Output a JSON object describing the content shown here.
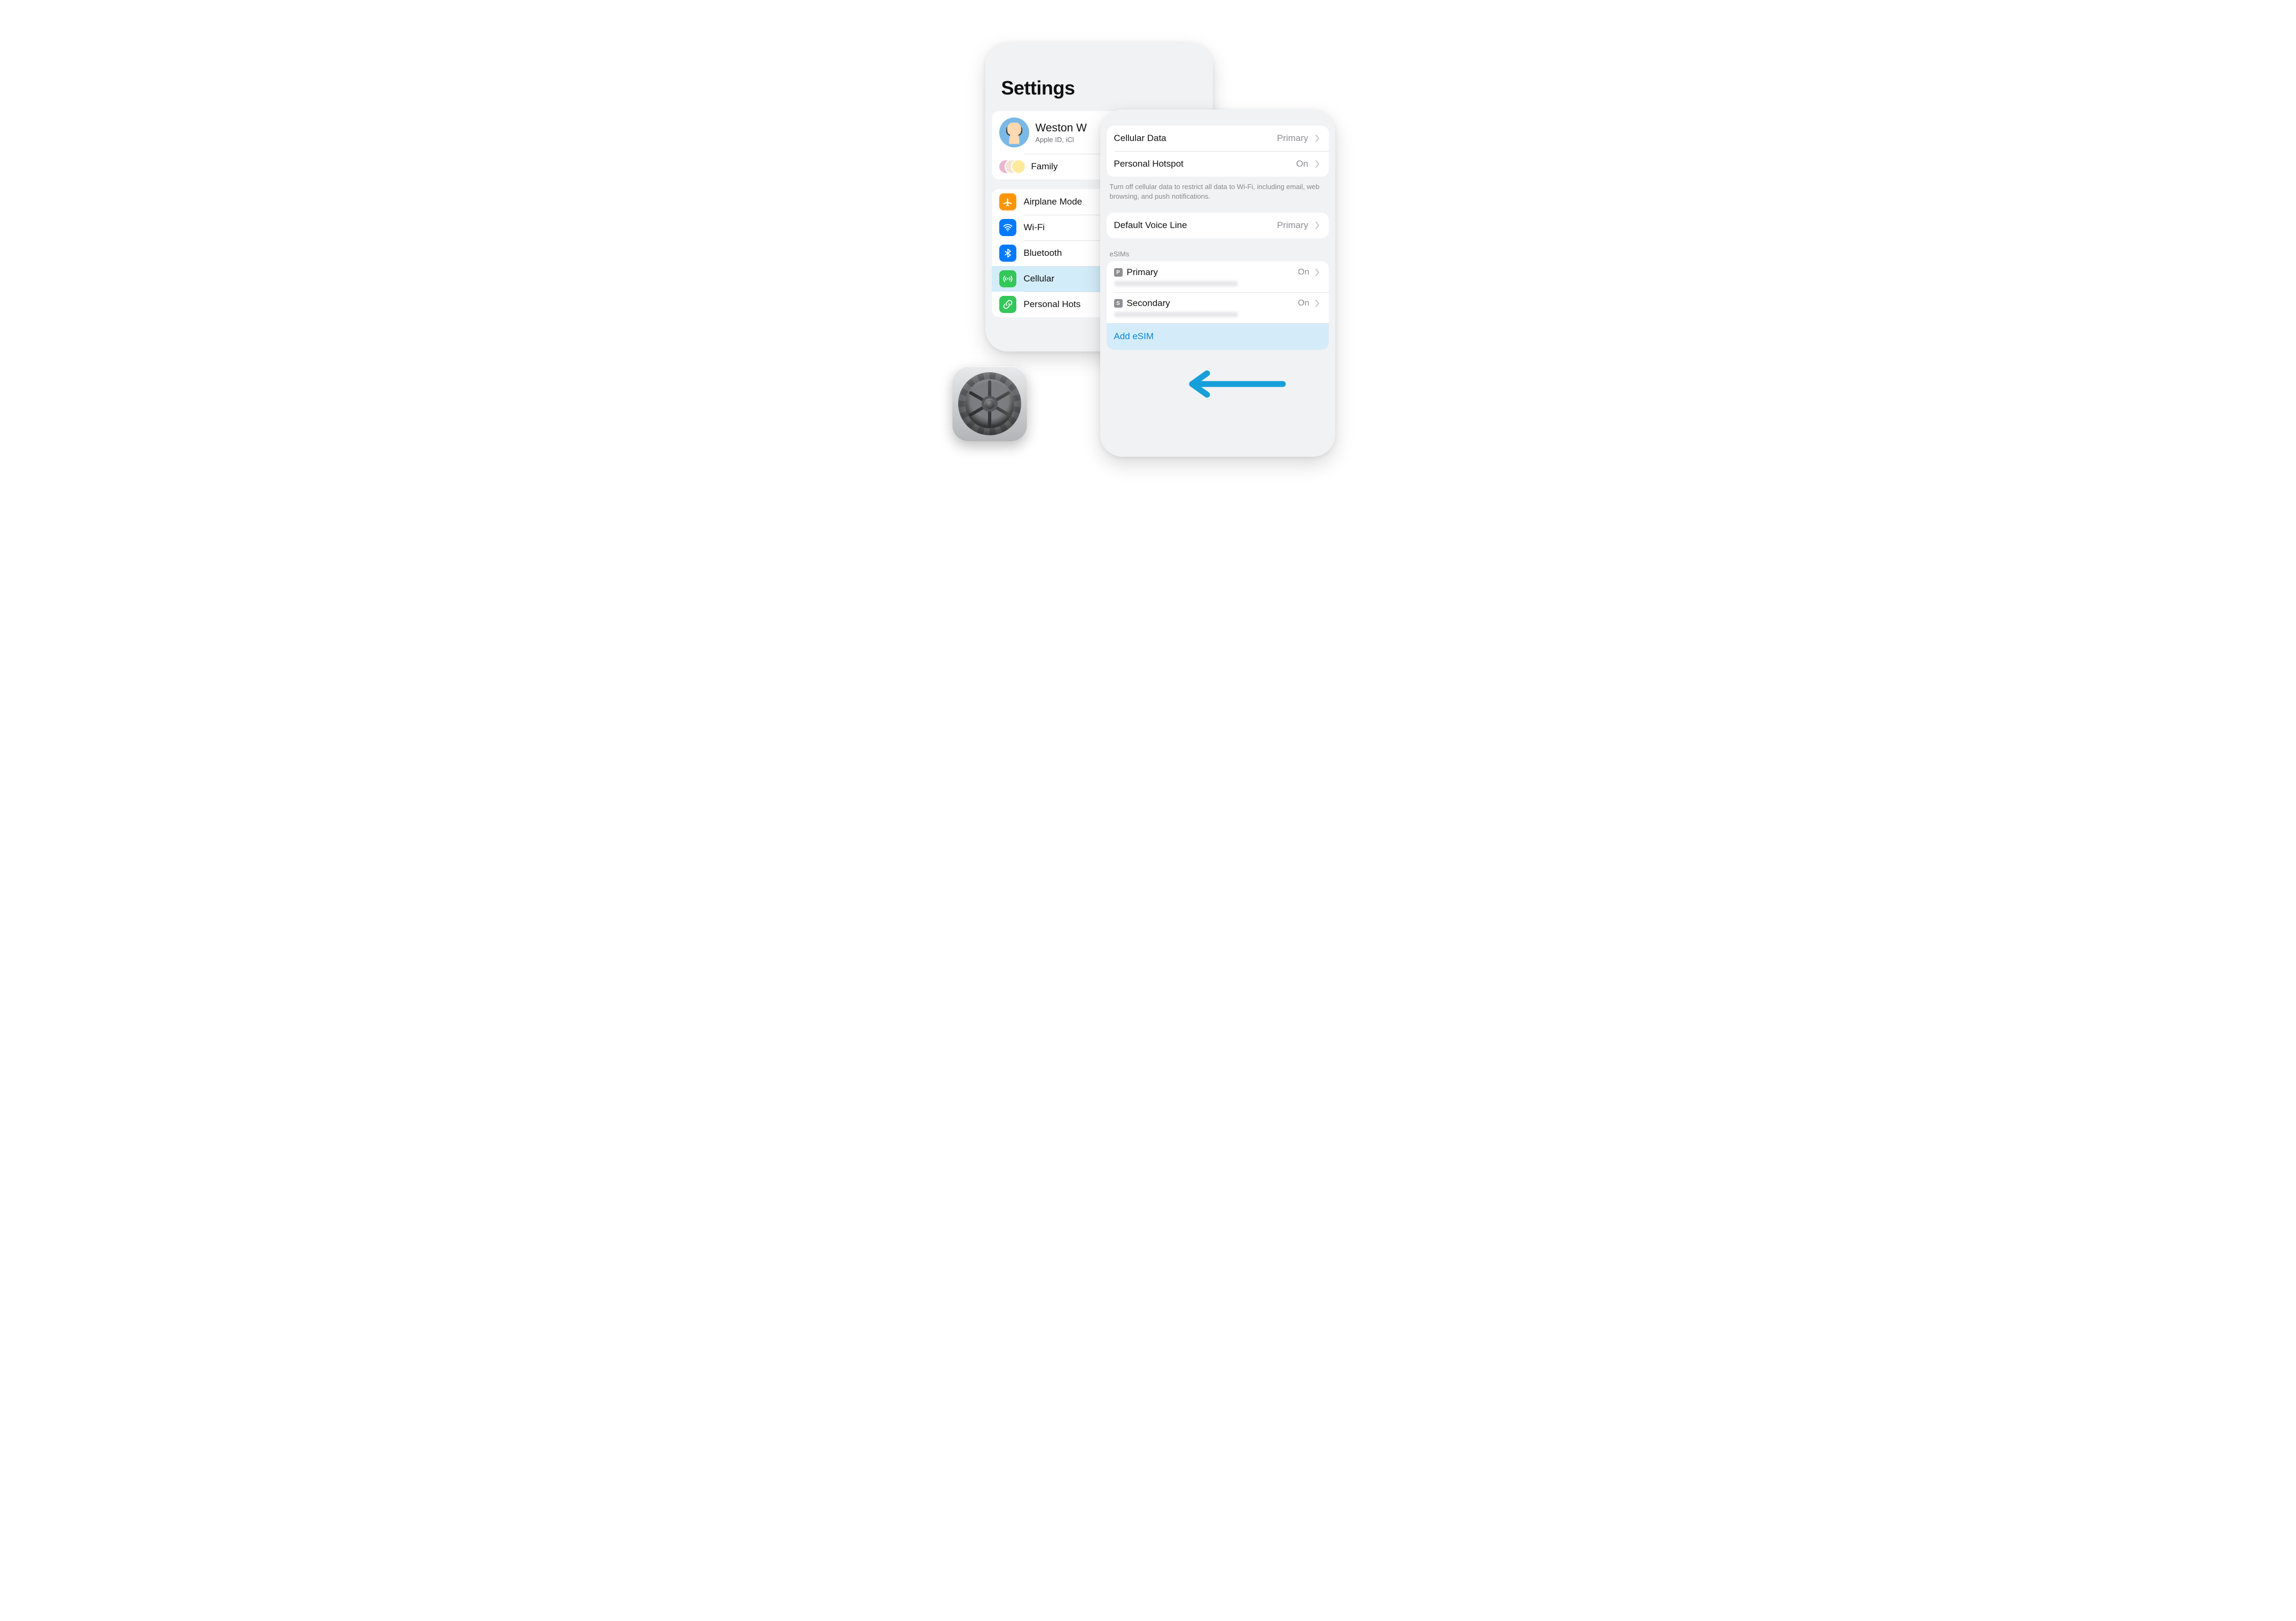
{
  "accent": "#0b84d9",
  "settings": {
    "title": "Settings",
    "account": {
      "name": "Weston W",
      "subtitle": "Apple ID, iCl"
    },
    "family_label": "Family",
    "items": [
      {
        "label": "Airplane Mode",
        "icon": "airplane",
        "tint": "orange"
      },
      {
        "label": "Wi-Fi",
        "icon": "wifi",
        "tint": "blue"
      },
      {
        "label": "Bluetooth",
        "icon": "bluetooth",
        "tint": "blue"
      },
      {
        "label": "Cellular",
        "icon": "antenna",
        "tint": "green",
        "selected": true
      },
      {
        "label": "Personal Hots",
        "icon": "link",
        "tint": "green"
      }
    ]
  },
  "cellular": {
    "rows1": [
      {
        "label": "Cellular Data",
        "value": "Primary"
      },
      {
        "label": "Personal Hotspot",
        "value": "On"
      }
    ],
    "rows1_footer": "Turn off cellular data to restrict all data to Wi-Fi, including email, web browsing, and push notifications.",
    "rows2": [
      {
        "label": "Default Voice Line",
        "value": "Primary"
      }
    ],
    "esims_header": "eSIMs",
    "esims": [
      {
        "tag": "P",
        "name": "Primary",
        "state": "On"
      },
      {
        "tag": "S",
        "name": "Secondary",
        "state": "On"
      }
    ],
    "add_label": "Add eSIM"
  }
}
